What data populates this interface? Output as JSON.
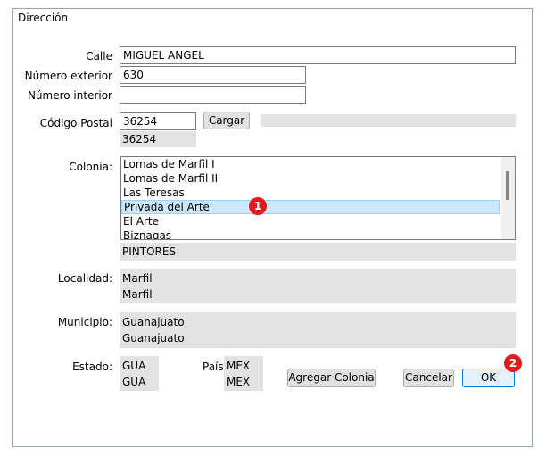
{
  "dialog": {
    "title": "Dirección"
  },
  "fields": {
    "calle": {
      "label": "Calle",
      "value": "MIGUEL ANGEL"
    },
    "numero_exterior": {
      "label": "Número exterior",
      "value": "630"
    },
    "numero_interior": {
      "label": "Número interior",
      "value": ""
    },
    "codigo_postal": {
      "label": "Código Postal",
      "value": "36254",
      "echo": "36254",
      "load_label": "Cargar"
    },
    "colonia": {
      "label": "Colonia:",
      "items": [
        "Lomas de Marfil I",
        "Lomas de Marfil II",
        "Las Teresas",
        "Privada del Arte",
        "El Arte",
        "Biznagas"
      ],
      "selected_index": 3,
      "below_value": "PINTORES"
    },
    "localidad": {
      "label": "Localidad:",
      "line1": "Marfil",
      "line2": "Marfil"
    },
    "municipio": {
      "label": "Municipio:",
      "line1": "Guanajuato",
      "line2": "Guanajuato"
    },
    "estado": {
      "label": "Estado:",
      "line1": "GUA",
      "line2": "GUA"
    },
    "pais": {
      "label": "País",
      "line1": "MEX",
      "line2": "MEX"
    }
  },
  "buttons": {
    "agregar_colonia": "Agregar Colonia",
    "cancelar": "Cancelar",
    "ok": "OK"
  },
  "callouts": {
    "one": "1",
    "two": "2"
  },
  "colors": {
    "callout": "#e11b1b",
    "selection": "#cce8ff",
    "primary_border": "#0078d7"
  }
}
